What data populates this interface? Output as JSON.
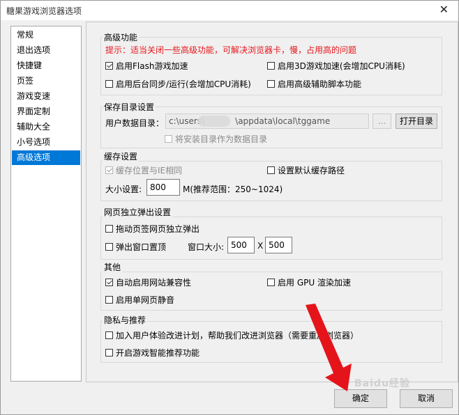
{
  "window": {
    "title": "糖果游戏浏览器选项",
    "close_glyph": "✕"
  },
  "nav": {
    "items": [
      "常规",
      "退出选项",
      "快捷键",
      "页签",
      "游戏变速",
      "界面定制",
      "辅助大全",
      "小号选项",
      "高级选项"
    ],
    "selected": 8
  },
  "advanced": {
    "title": "高级功能",
    "hint": "提示：适当关闭一些高级功能，可解决浏览器卡，慢，占用高的问题",
    "flash": "启用Flash游戏加速",
    "game3d": "启用3D游戏加速(会增加CPU消耗)",
    "bgsync": "启用后台同步/运行(会增加CPU消耗)",
    "script": "启用高级辅助脚本功能"
  },
  "savedir": {
    "title": "保存目录设置",
    "label": "用户数据目录：",
    "path_start": "c:\\users\\",
    "path_end": "\\appdata\\local\\tggame",
    "browse": "...",
    "open": "打开目录",
    "use_install": "将安装目录作为数据目录"
  },
  "cache": {
    "title": "缓存设置",
    "same_as_ie": "缓存位置与IE相同",
    "default_path": "设置默认缓存路径",
    "size_label": "大小设置:",
    "size_value": "800",
    "range": "M(推荐范围：250~1024)"
  },
  "popup": {
    "title": "网页独立弹出设置",
    "drag_tab": "拖动页签网页独立弹出",
    "topmost": "弹出窗口置顶",
    "win_size_label": "窗口大小:",
    "width": "500",
    "x": "X",
    "height": "500"
  },
  "other": {
    "title": "其他",
    "compat": "自动启用网站兼容性",
    "gpu": "启用 GPU 渲染加速",
    "mute": "启用单网页静音"
  },
  "privacy": {
    "title": "隐私与推荐",
    "improve": "加入用户体验改进计划，帮助我们改进浏览器（需要重启浏览器）",
    "recommend": "开启游戏智能推荐功能"
  },
  "footer": {
    "ok": "确定",
    "cancel": "取消"
  },
  "watermark": "Baidu经验",
  "colors": {
    "selection": "#0078d7",
    "hint": "#e8161b",
    "arrow": "#e5141b"
  }
}
